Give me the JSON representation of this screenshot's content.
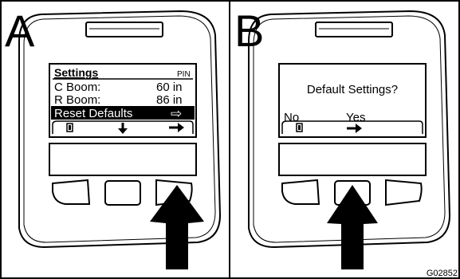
{
  "panels": [
    {
      "letter": "A",
      "screen": {
        "header_title": "Settings",
        "header_tag": "PIN",
        "rows": [
          {
            "label": "C Boom:",
            "value": "60 in"
          },
          {
            "label": "R Boom:",
            "value": "86 in"
          }
        ],
        "selected_row": {
          "label": "Reset Defaults",
          "glyph": "⇨"
        },
        "softkeys": [
          "exit-icon",
          "down-arrow-icon",
          "right-arrow-icon"
        ]
      },
      "pressed_button": "right"
    },
    {
      "letter": "B",
      "screen": {
        "prompt": "Default Settings?",
        "options": [
          "No",
          "Yes"
        ],
        "softkeys": [
          "exit-icon",
          "right-arrow-icon"
        ]
      },
      "pressed_button": "center"
    }
  ],
  "figure_id": "G02852"
}
